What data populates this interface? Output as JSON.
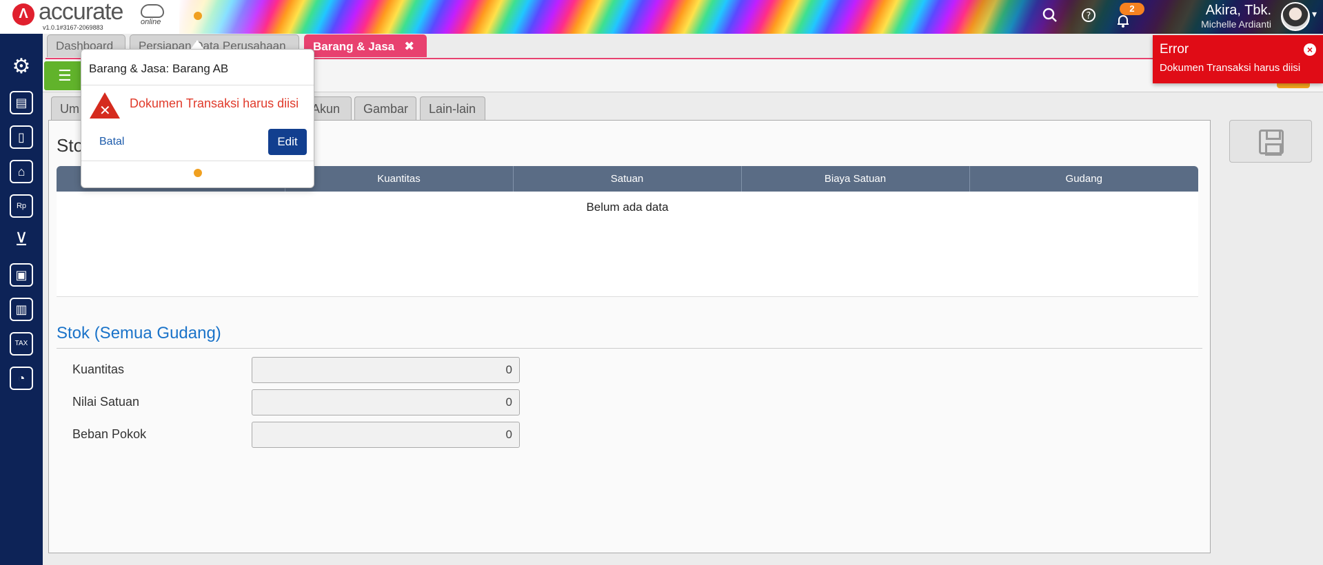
{
  "header": {
    "brand": "accurate",
    "brand_sub": "online",
    "version": "v1.0.1#3167-2069883",
    "notification_count": "2",
    "user_name": "Akira, Tbk.",
    "user_sub": "Michelle Ardianti"
  },
  "tabs": [
    {
      "label": "Dashboard"
    },
    {
      "label": "Persiapan Data Perusahaan"
    },
    {
      "label": "Barang & Jasa",
      "close": "✖"
    }
  ],
  "subtabs": [
    {
      "label": "Um"
    },
    {
      "label": "Akun"
    },
    {
      "label": "Gambar"
    },
    {
      "label": "Lain-lain"
    }
  ],
  "panel": {
    "title": "Sto",
    "table": {
      "headers": [
        "",
        "Kuantitas",
        "Satuan",
        "Biaya Satuan",
        "Gudang"
      ],
      "empty_text": "Belum ada data"
    },
    "section_title": "Stok (Semua Gudang)",
    "fields": [
      {
        "label": "Kuantitas",
        "value": "0"
      },
      {
        "label": "Nilai Satuan",
        "value": "0"
      },
      {
        "label": "Beban Pokok",
        "value": "0"
      }
    ]
  },
  "popover": {
    "title": "Barang & Jasa: Barang AB",
    "message": "Dokumen Transaksi harus diisi",
    "cancel_label": "Batal",
    "edit_label": "Edit"
  },
  "toast": {
    "title": "Error",
    "message": "Dokumen Transaksi harus diisi",
    "close": "×"
  },
  "colors": {
    "sidebar": "#0d2357",
    "active_tab": "#e8416f",
    "error": "#e00c16",
    "table_header": "#5a6c85",
    "section_title": "#1a73c9",
    "edit_button": "#123f8f"
  },
  "icons": [
    "gear-icon",
    "building-icon",
    "book-icon",
    "bank-icon",
    "money-bag-icon",
    "cart-icon",
    "trolley-icon",
    "factory-icon",
    "tax-icon",
    "report-icon"
  ]
}
